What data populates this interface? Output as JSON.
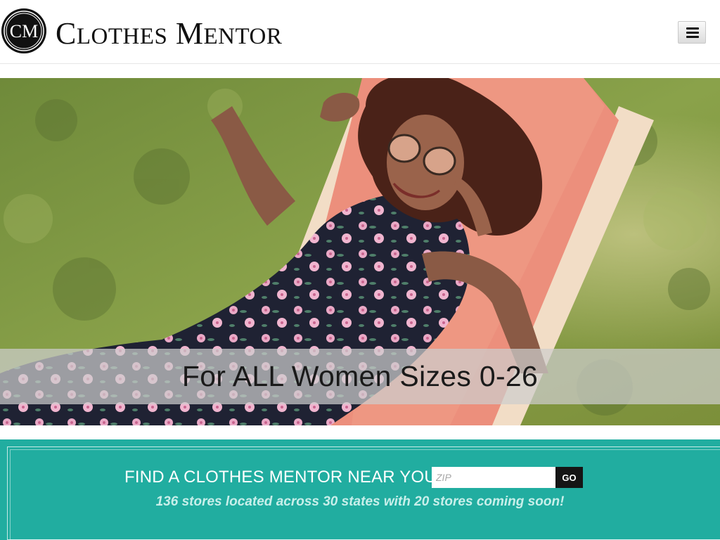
{
  "header": {
    "logo_monogram": "CM",
    "brand_first_cap": "C",
    "brand_first_rest": "LOTHES",
    "brand_second_cap": "M",
    "brand_second_rest": "ENTOR",
    "menu_icon": "hamburger-icon"
  },
  "hero": {
    "caption": "For ALL Women Sizes 0-26"
  },
  "finder": {
    "title": "FIND A CLOTHES MENTOR NEAR YOU",
    "zip_placeholder": "ZIP",
    "zip_value": "",
    "go_label": "GO",
    "subtitle": "136 stores located across 30 states with 20 stores coming soon!"
  },
  "colors": {
    "accent": "#21ada0",
    "brand_text": "#111111",
    "go_button": "#151515",
    "subtitle": "#c8efea"
  }
}
